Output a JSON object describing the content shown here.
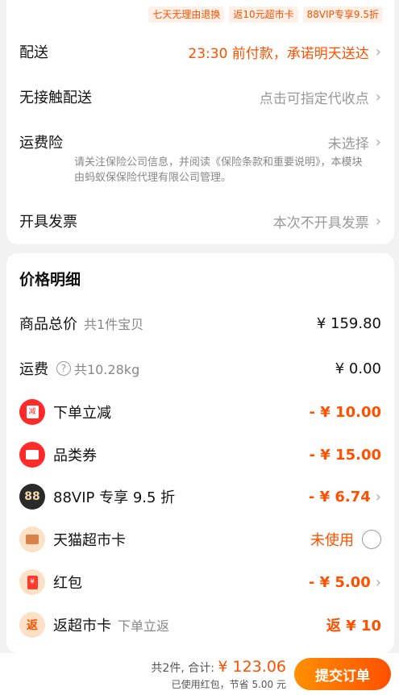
{
  "top_tags": [
    "七天无理由退换",
    "返10元超市卡",
    "88VIP专享9.5折"
  ],
  "delivery": {
    "shipping": {
      "label": "配送",
      "value": "23:30 前付款，承诺明天送达"
    },
    "contactless": {
      "label": "无接触配送",
      "value": "点击可指定代收点"
    },
    "freight_insurance": {
      "label": "运费险",
      "value": "未选择",
      "note": "请关注保险公司信息，并阅读《保险条款和重要说明》，本模块由蚂蚁保保险代理有限公司管理。"
    },
    "invoice": {
      "label": "开具发票",
      "value": "本次不开具发票"
    }
  },
  "price": {
    "title": "价格明细",
    "goods_total": {
      "label": "商品总价",
      "sub": "共1件宝贝",
      "amount": "¥ 159.80"
    },
    "freight": {
      "label": "运费",
      "sub": "共10.28kg",
      "amount": "¥ 0.00"
    },
    "instant_discount": {
      "label": "下单立减",
      "amount": "- ¥ 10.00",
      "icon_text": "减"
    },
    "category_coupon": {
      "label": "品类券",
      "amount": "- ¥ 15.00"
    },
    "vip88": {
      "label": "88VIP 专享 9.5 折",
      "amount": "- ¥ 6.74",
      "badge": "88"
    },
    "supermarket_card": {
      "label": "天猫超市卡",
      "amount": "未使用"
    },
    "red_packet": {
      "label": "红包",
      "amount": "- ¥ 5.00",
      "icon_text": "¥"
    },
    "rebate_card": {
      "label": "返超市卡",
      "sub": "下单立返",
      "amount": "返 ¥ 10",
      "icon_text": "返"
    }
  },
  "footer": {
    "count": "共2件,",
    "total_label": "合计:",
    "total": "¥ 123.06",
    "saved_text": "已使用红包，节省 5.00 元",
    "submit": "提交订单"
  },
  "colors": {
    "accent": "#ff5000",
    "background": "#f2f2f2"
  },
  "icons": [
    "chevron-right-icon",
    "discount-icon",
    "coupon-icon",
    "vip88-icon",
    "wallet-card-icon",
    "red-packet-icon",
    "rebate-icon",
    "question-icon"
  ]
}
